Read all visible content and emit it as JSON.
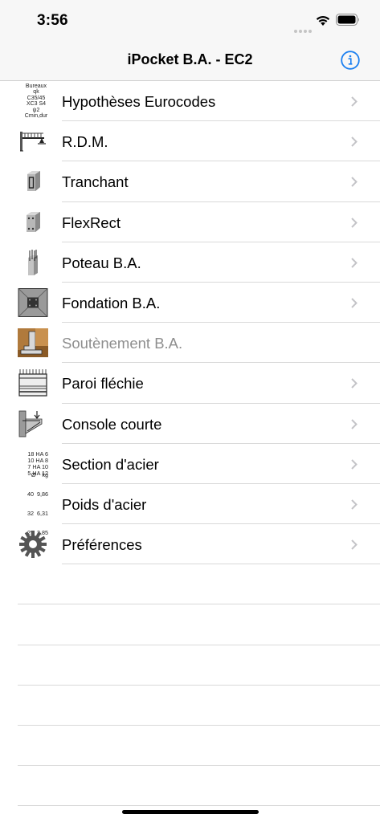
{
  "status_bar": {
    "time": "3:56"
  },
  "nav": {
    "title": "iPocket B.A. - EC2",
    "info_icon": "info-circle-icon",
    "accent_color": "#1a7ff0"
  },
  "items": [
    {
      "label": "Hypothèses Eurocodes",
      "icon": "eurocode-hypotheses-icon",
      "enabled": true,
      "icon_text": [
        "Bureaux",
        "qk C35/45",
        "XC3 S4 ψ2",
        "Cmin,dur"
      ]
    },
    {
      "label": "R.D.M.",
      "icon": "beam-icon",
      "enabled": true
    },
    {
      "label": "Tranchant",
      "icon": "shear-block-icon",
      "enabled": true
    },
    {
      "label": "FlexRect",
      "icon": "flexrect-block-icon",
      "enabled": true
    },
    {
      "label": "Poteau B.A.",
      "icon": "column-icon",
      "enabled": true
    },
    {
      "label": "Fondation B.A.",
      "icon": "foundation-icon",
      "enabled": true
    },
    {
      "label": "Soutènement B.A.",
      "icon": "retaining-wall-icon",
      "enabled": false
    },
    {
      "label": "Paroi fléchie",
      "icon": "deep-beam-icon",
      "enabled": true
    },
    {
      "label": "Console courte",
      "icon": "corbel-icon",
      "enabled": true
    },
    {
      "label": "Section d'acier",
      "icon": "steel-section-icon",
      "enabled": true,
      "icon_text": [
        "18 HA  6",
        "10 HA  8",
        "7 HA 10",
        "5 HA 12"
      ]
    },
    {
      "label": "Poids d'acier",
      "icon": "steel-weight-icon",
      "enabled": true,
      "icon_text": [
        "Ø    kg",
        "40  9,86",
        "32  6,31",
        "25  3,85"
      ]
    },
    {
      "label": "Préférences",
      "icon": "gear-icon",
      "enabled": true
    }
  ]
}
